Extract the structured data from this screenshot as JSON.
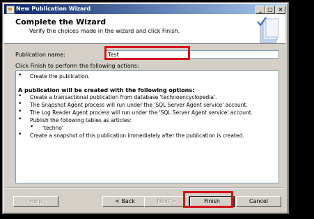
{
  "window": {
    "title": "New Publication Wizard",
    "min_glyph": "_",
    "max_glyph": "□",
    "close_glyph": "×"
  },
  "header": {
    "title": "Complete the Wizard",
    "subtitle": "Verify the choices made in the wizard and click Finish."
  },
  "form": {
    "publication_name_label": "Publication name:",
    "publication_name_value": "Test",
    "actions_label": "Click Finish to perform the following actions:"
  },
  "summary": {
    "line1": "Create the publication.",
    "heading": "A publication will be created with the following options:",
    "opt1": "Create a transactional publication from database 'technoencyclopedia'.",
    "opt2": "The Snapshot Agent process will run under the 'SQL Server Agent service' account.",
    "opt3": "The Log Reader Agent process will run under the 'SQL Server Agent service' account.",
    "opt4": "Publish the following tables as articles:",
    "sub1": "'techno'",
    "opt5": "Create a snapshot of this publication immediately after the publication is created."
  },
  "buttons": {
    "help": "Help",
    "back": "< Back",
    "next": "Next >",
    "finish": "Finish",
    "cancel": "Cancel"
  },
  "colors": {
    "highlight": "#d5111a",
    "title_bar_start": "#0a246a",
    "title_bar_end": "#a6caf0"
  }
}
